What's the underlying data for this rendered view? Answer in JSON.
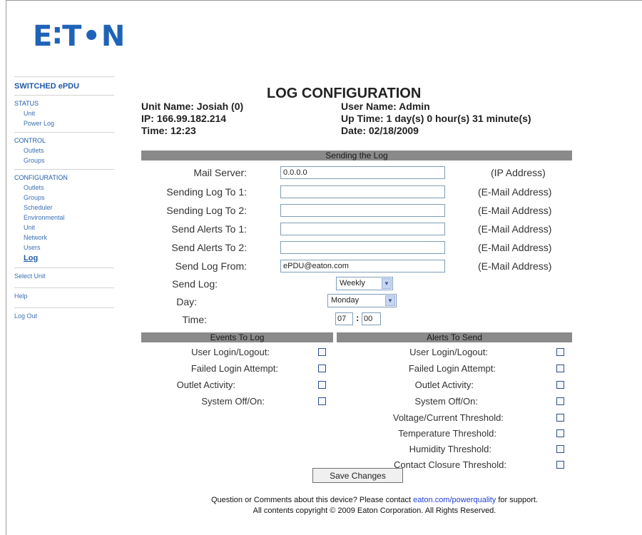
{
  "brand": {
    "logo_text": "E∶T•N",
    "accent": "#1f63b8"
  },
  "sidebar": {
    "title": "SWITCHED ePDU",
    "status": {
      "heading": "STATUS",
      "items": [
        "Unit",
        "Power Log"
      ]
    },
    "control": {
      "heading": "CONTROL",
      "items": [
        "Outlets",
        "Groups"
      ]
    },
    "configuration": {
      "heading": "CONFIGURATION",
      "items": [
        "Outlets",
        "Groups",
        "Scheduler",
        "Environmental",
        "Unit",
        "Network",
        "Users",
        "Log"
      ]
    },
    "links": [
      "Select Unit",
      "Help",
      "Log Out"
    ]
  },
  "header": {
    "title": "LOG CONFIGURATION",
    "unit_name": "Unit Name: Josiah (0)",
    "ip": "IP: 166.99.182.214",
    "time": "Time: 12:23",
    "user_name": "User Name: Admin",
    "up_time": "Up Time: 1 day(s) 0 hour(s) 31 minute(s)",
    "date": "Date: 02/18/2009"
  },
  "sending": {
    "section_title": "Sending the Log",
    "rows": [
      {
        "label": "Mail Server:",
        "value": "0.0.0.0",
        "unit": "(IP Address)"
      },
      {
        "label": "Sending Log To 1:",
        "value": "",
        "unit": "(E-Mail Address)"
      },
      {
        "label": "Sending Log To 2:",
        "value": "",
        "unit": "(E-Mail Address)"
      },
      {
        "label": "Send Alerts To 1:",
        "value": "",
        "unit": "(E-Mail Address)"
      },
      {
        "label": "Send Alerts To 2:",
        "value": "",
        "unit": "(E-Mail Address)"
      },
      {
        "label": "Send Log From:",
        "value": "ePDU@eaton.com",
        "unit": "(E-Mail Address)"
      }
    ],
    "send_log_label": "Send Log:",
    "send_log_value": "Weekly",
    "day_label": "Day:",
    "day_value": "Monday",
    "time_label": "Time:",
    "time_hour": "07",
    "time_sep": ":",
    "time_minute": "00"
  },
  "events": {
    "section_title": "Events To Log",
    "items": [
      "User Login/Logout:",
      "Failed Login Attempt:",
      "Outlet Activity:",
      "System Off/On:"
    ]
  },
  "alerts": {
    "section_title": "Alerts To Send",
    "items": [
      "User Login/Logout:",
      "Failed Login Attempt:",
      "Outlet Activity:",
      "System Off/On:",
      "Voltage/Current Threshold:",
      "Temperature Threshold:",
      "Humidity Threshold:",
      "Contact Closure Threshold:"
    ]
  },
  "save_label": "Save Changes",
  "footer": {
    "line1_pre": "Question or Comments about this device? Please contact ",
    "line1_link": "eaton.com/powerquality",
    "line1_post": " for support.",
    "line2": "All contents copyright © 2009 Eaton Corporation. All Rights Reserved."
  }
}
